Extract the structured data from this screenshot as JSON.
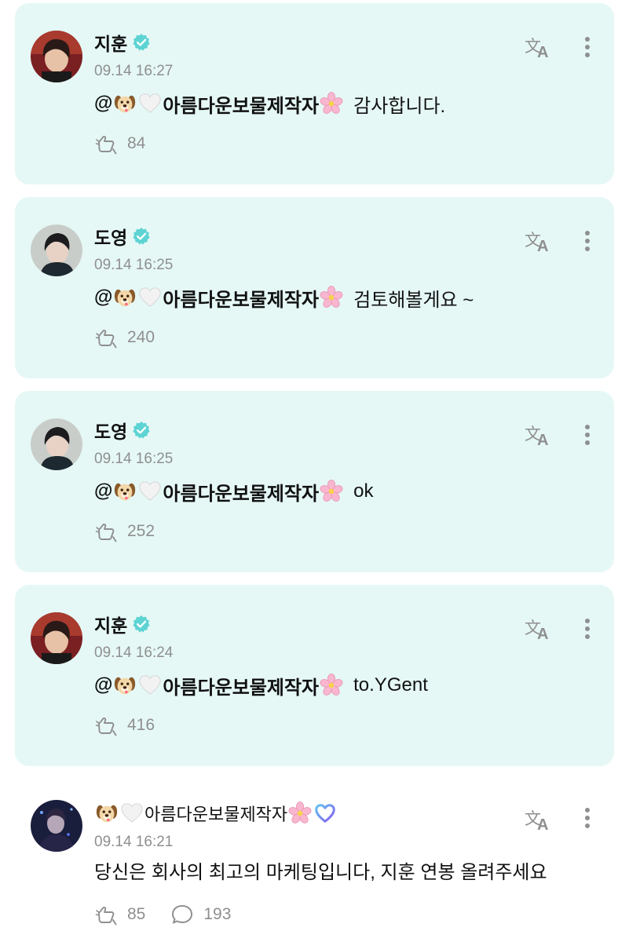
{
  "cards": [
    {
      "name": "지훈",
      "time": "09.14 16:27",
      "mention": "@",
      "mention_user": "아름다운보물제작자",
      "message": "감사합니다.",
      "likes": "84"
    },
    {
      "name": "도영",
      "time": "09.14 16:25",
      "mention": "@",
      "mention_user": "아름다운보물제작자",
      "message": "검토해볼게요 ~",
      "likes": "240"
    },
    {
      "name": "도영",
      "time": "09.14 16:25",
      "mention": "@",
      "mention_user": "아름다운보물제작자",
      "message": "ok",
      "likes": "252"
    },
    {
      "name": "지훈",
      "time": "09.14 16:24",
      "mention": "@",
      "mention_user": "아름다운보물제작자",
      "message": "to.YGent",
      "likes": "416"
    }
  ],
  "original": {
    "name": "아름다운보물제작자",
    "time": "09.14 16:21",
    "message": "당신은 회사의 최고의 마케팅입니다, 지훈 연봉 올려주세요",
    "likes": "85",
    "comments": "193"
  },
  "colors": {
    "card_bg": "#e5f8f6",
    "verified": "#5dd3d3",
    "muted": "#8f8f8f",
    "fan_badge_start": "#5fc3f0",
    "fan_badge_end": "#8a5cf0"
  },
  "icons": [
    "verified-badge-icon",
    "translate-icon",
    "more-options-icon",
    "like-icon",
    "comment-icon",
    "dog-emoji",
    "white-heart-emoji",
    "cherry-blossom-emoji"
  ]
}
